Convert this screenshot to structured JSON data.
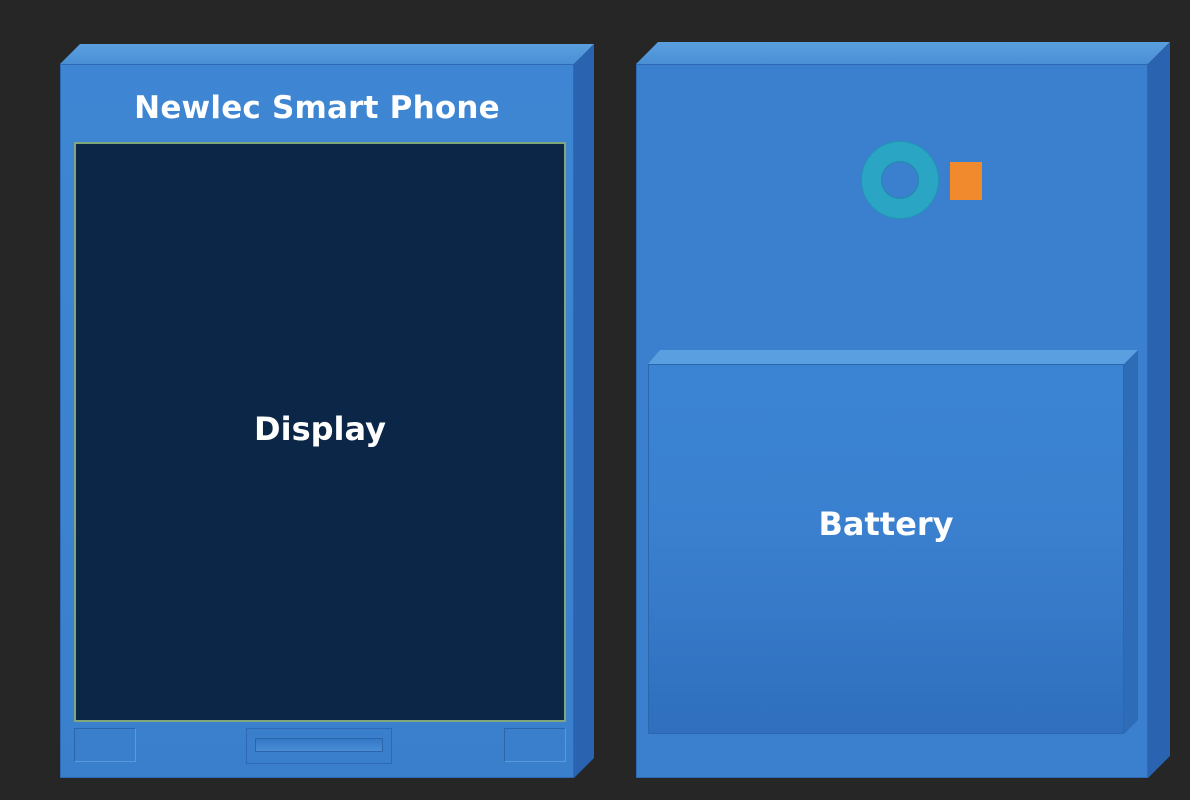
{
  "phone_front": {
    "title": "Newlec Smart Phone",
    "display_label": "Display"
  },
  "phone_back": {
    "battery_label": "Battery"
  },
  "colors": {
    "background": "#262626",
    "body": "#3a80cf",
    "display": "#0b2646",
    "camera": "#2aa6c4",
    "flash": "#f08a2c"
  }
}
